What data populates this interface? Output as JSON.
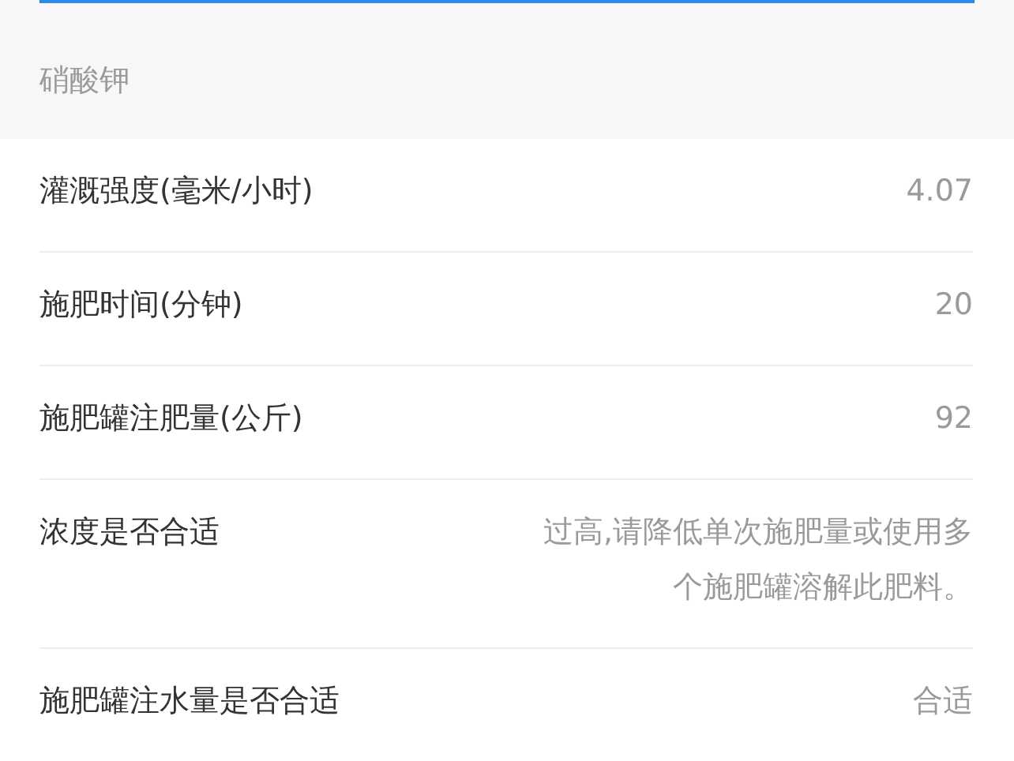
{
  "section_title": "硝酸钾",
  "rows": [
    {
      "label": "灌溉强度(毫米/小时)",
      "value": "4.07"
    },
    {
      "label": "施肥时间(分钟)",
      "value": "20"
    },
    {
      "label": "施肥罐注肥量(公斤)",
      "value": "92"
    },
    {
      "label": "浓度是否合适",
      "value": "过高,请降低单次施肥量或使用多个施肥罐溶解此肥料。"
    },
    {
      "label": "施肥罐注水量是否合适",
      "value": "合适"
    }
  ]
}
